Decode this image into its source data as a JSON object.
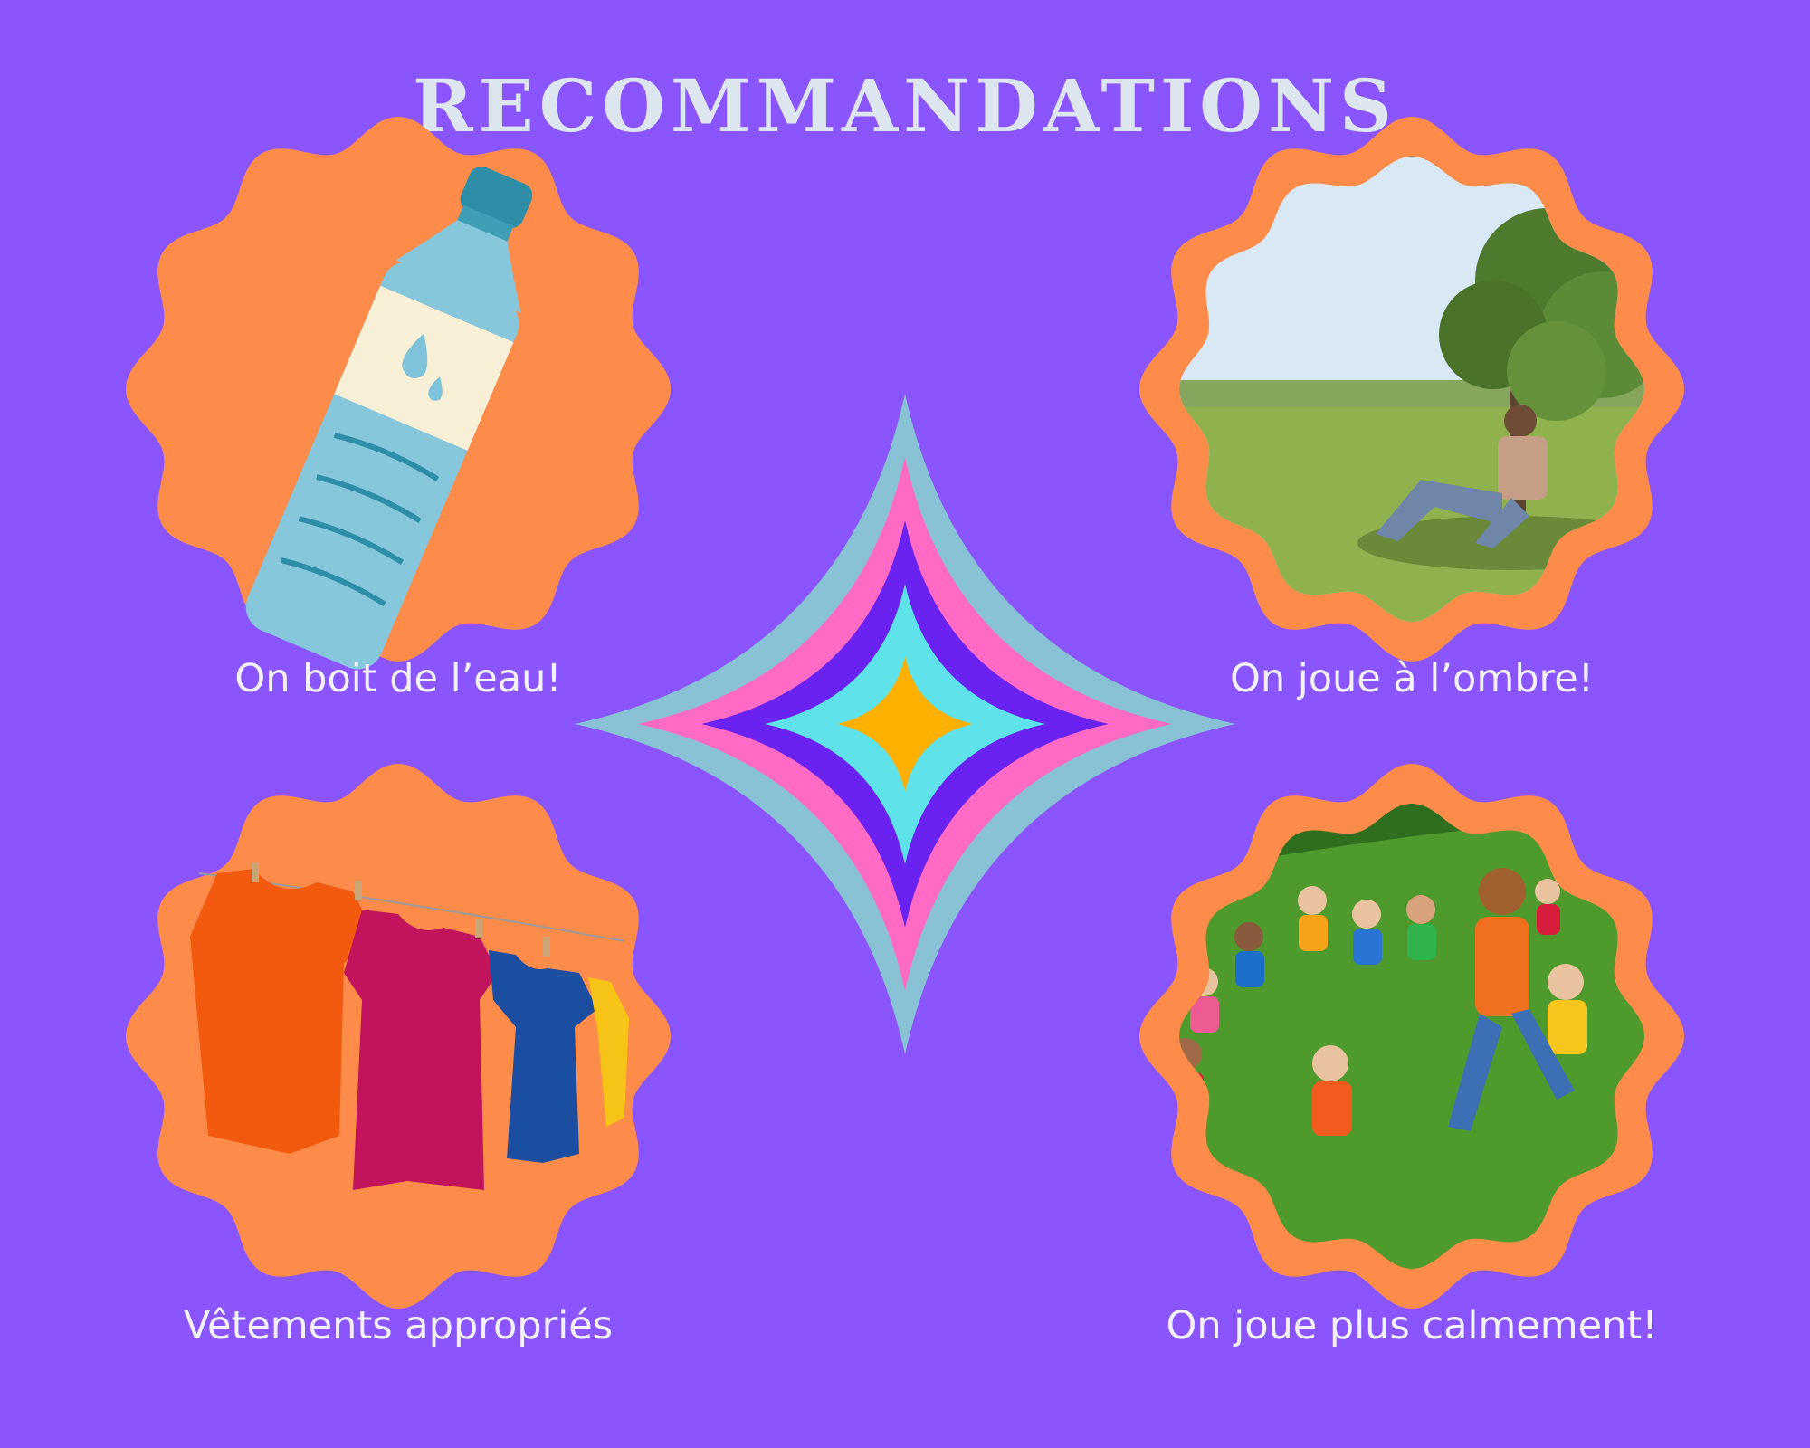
{
  "title": "RECOMMANDATIONS",
  "items": [
    {
      "caption": "On boit de l’eau!",
      "icon": "water-bottle-icon"
    },
    {
      "caption": "On joue à l’ombre!",
      "icon": "man-in-shade-photo"
    },
    {
      "caption": "Vêtements appropriés",
      "icon": "clothesline-tshirts-photo"
    },
    {
      "caption": "On joue plus calmement!",
      "icon": "children-playing-photo"
    }
  ],
  "colors": {
    "background": "#8b55fd",
    "badge": "#fd8c4a",
    "title": "#dde6ef",
    "star_layers": [
      "#88c2d4",
      "#ff6ac5",
      "#6a22f0",
      "#5fe2ea",
      "#ffb000"
    ]
  }
}
